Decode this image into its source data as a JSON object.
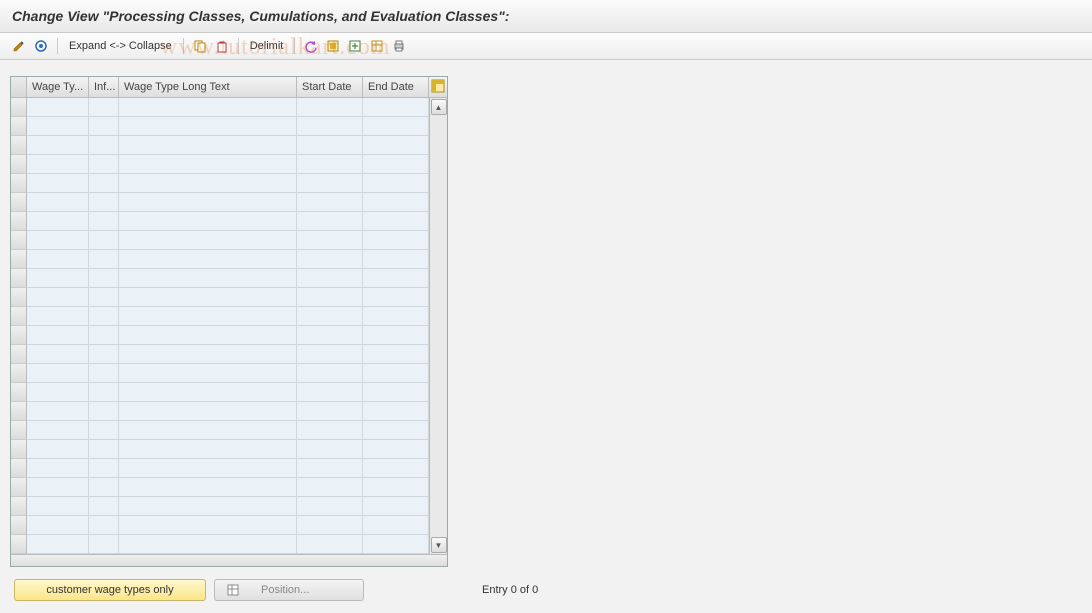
{
  "header": {
    "title": "Change View \"Processing Classes, Cumulations, and Evaluation Classes\":"
  },
  "toolbar": {
    "expand_collapse": "Expand <-> Collapse",
    "delimit": "Delimit"
  },
  "columns": {
    "wage_type": "Wage Ty...",
    "inf": "Inf...",
    "long_text": "Wage Type Long Text",
    "start_date": "Start Date",
    "end_date": "End Date"
  },
  "footer": {
    "customer_button": "customer wage types only",
    "position_button": "Position...",
    "entries_text": "Entry 0 of 0"
  },
  "watermark": "www.tutorialkart.com",
  "row_count": 24
}
